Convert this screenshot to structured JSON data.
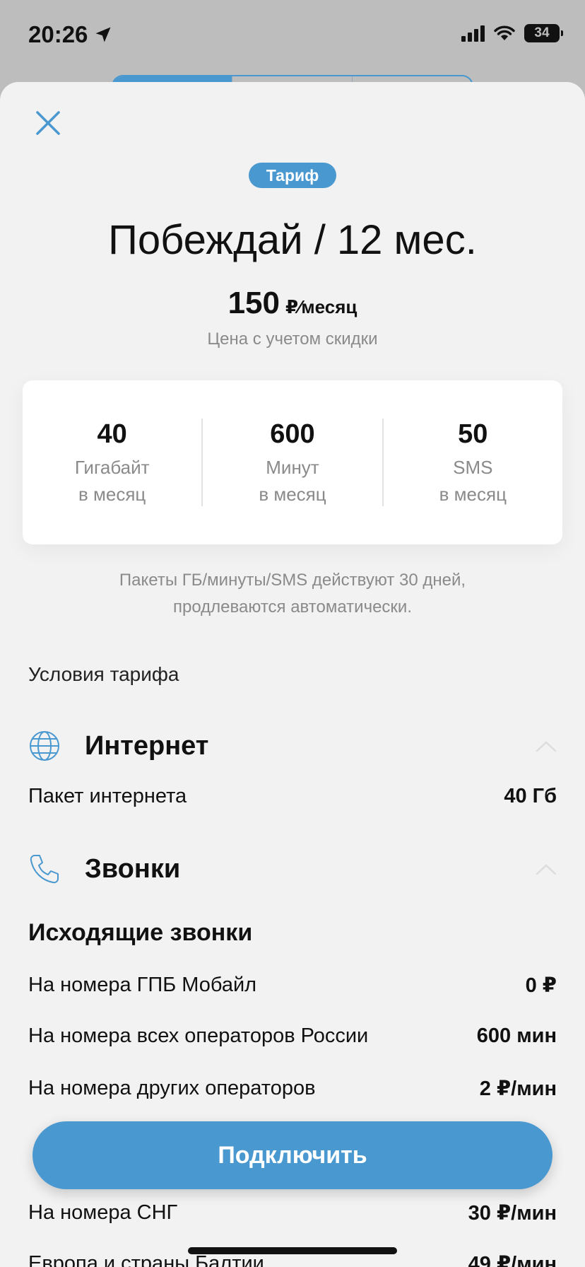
{
  "status": {
    "time": "20:26",
    "battery": "34"
  },
  "sheet": {
    "badge": "Тариф",
    "title": "Побеждай / 12 мес.",
    "price": {
      "value": "150",
      "unit": "₽⁄месяц",
      "note": "Цена с учетом скидки"
    },
    "stats": [
      {
        "value": "40",
        "label": "Гигабайт",
        "sub": "в месяц"
      },
      {
        "value": "600",
        "label": "Минут",
        "sub": "в месяц"
      },
      {
        "value": "50",
        "label": "SMS",
        "sub": "в месяц"
      }
    ],
    "packets_note": "Пакеты ГБ/минуты/SMS действуют 30 дней, продлеваются автоматически.",
    "conditions_title": "Условия тарифа",
    "internet": {
      "title": "Интернет",
      "rows": [
        {
          "label": "Пакет интернета",
          "value": "40 Гб"
        }
      ]
    },
    "calls": {
      "title": "Звонки",
      "outgoing_title": "Исходящие звонки",
      "rows": [
        {
          "label": "На номера ГПБ Мобайл",
          "value": "0 ₽"
        },
        {
          "label": "На номера всех операторов России",
          "value": "600 мин"
        },
        {
          "label": "На номера других операторов",
          "value": "2 ₽/мин"
        }
      ],
      "intl_rows": [
        {
          "label": "На номера СНГ",
          "value": "30 ₽/мин"
        },
        {
          "label": "Европа и страны Балтии",
          "value": "49 ₽/мин"
        }
      ]
    },
    "connect_label": "Подключить"
  }
}
